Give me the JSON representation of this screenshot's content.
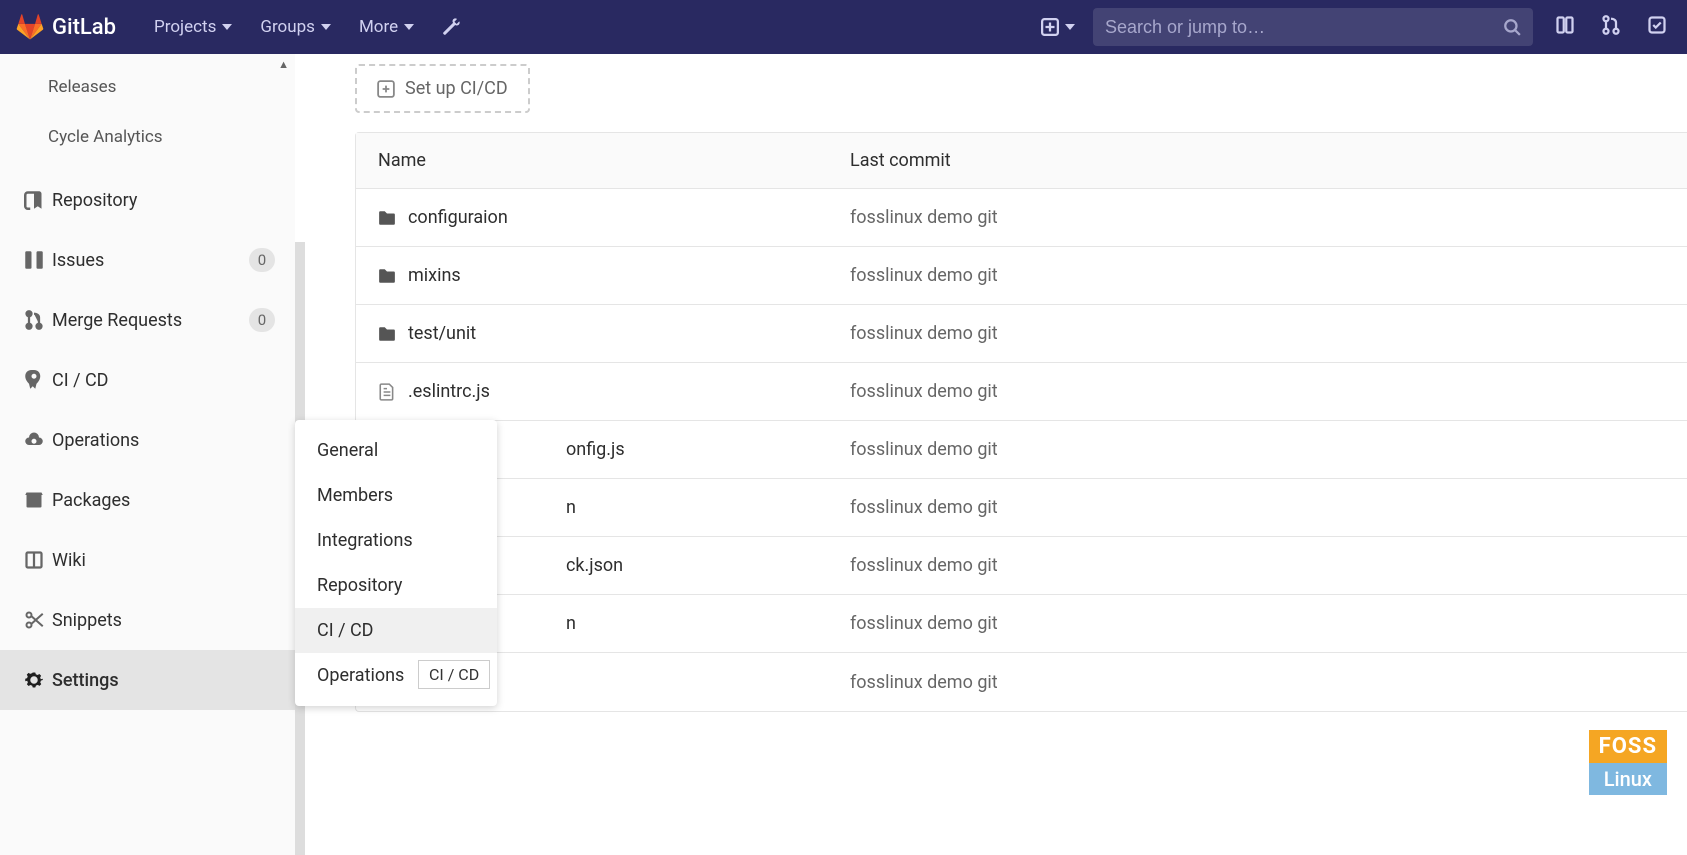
{
  "header": {
    "brand": "GitLab",
    "nav": [
      {
        "label": "Projects"
      },
      {
        "label": "Groups"
      },
      {
        "label": "More"
      }
    ],
    "search_placeholder": "Search or jump to…"
  },
  "sidebar": {
    "sub_items": [
      {
        "label": "Releases"
      },
      {
        "label": "Cycle Analytics"
      }
    ],
    "items": [
      {
        "label": "Repository",
        "icon": "repo"
      },
      {
        "label": "Issues",
        "icon": "issues",
        "badge": "0"
      },
      {
        "label": "Merge Requests",
        "icon": "merge",
        "badge": "0"
      },
      {
        "label": "CI / CD",
        "icon": "rocket"
      },
      {
        "label": "Operations",
        "icon": "cloud"
      },
      {
        "label": "Packages",
        "icon": "package"
      },
      {
        "label": "Wiki",
        "icon": "book"
      },
      {
        "label": "Snippets",
        "icon": "scissors"
      },
      {
        "label": "Settings",
        "icon": "gear",
        "active": true
      }
    ]
  },
  "flyout": {
    "items": [
      {
        "label": "General"
      },
      {
        "label": "Members"
      },
      {
        "label": "Integrations"
      },
      {
        "label": "Repository"
      },
      {
        "label": "CI / CD",
        "hover": true
      },
      {
        "label": "Operations"
      }
    ]
  },
  "tooltip": "CI / CD",
  "cicd_button": "Set up CI/CD",
  "table": {
    "headers": {
      "name": "Name",
      "commit": "Last commit"
    },
    "rows": [
      {
        "name": "configuraion",
        "type": "folder",
        "commit": "fosslinux demo git"
      },
      {
        "name": "mixins",
        "type": "folder",
        "commit": "fosslinux demo git"
      },
      {
        "name": "test/unit",
        "type": "folder",
        "commit": "fosslinux demo git"
      },
      {
        "name": ".eslintrc.js",
        "type": "file",
        "commit": "fosslinux demo git"
      },
      {
        "name": "onfig.js",
        "type": "file",
        "commit": "fosslinux demo git",
        "clipped": true
      },
      {
        "name": "n",
        "type": "file",
        "commit": "fosslinux demo git",
        "clipped": true
      },
      {
        "name": "ck.json",
        "type": "file",
        "commit": "fosslinux demo git",
        "clipped": true
      },
      {
        "name": "n",
        "type": "file",
        "commit": "fosslinux demo git",
        "clipped": true
      },
      {
        "name": "",
        "type": "file",
        "commit": "fosslinux demo git",
        "clipped": true
      }
    ]
  },
  "watermark": {
    "top": "FOSS",
    "bottom": "Linux"
  }
}
